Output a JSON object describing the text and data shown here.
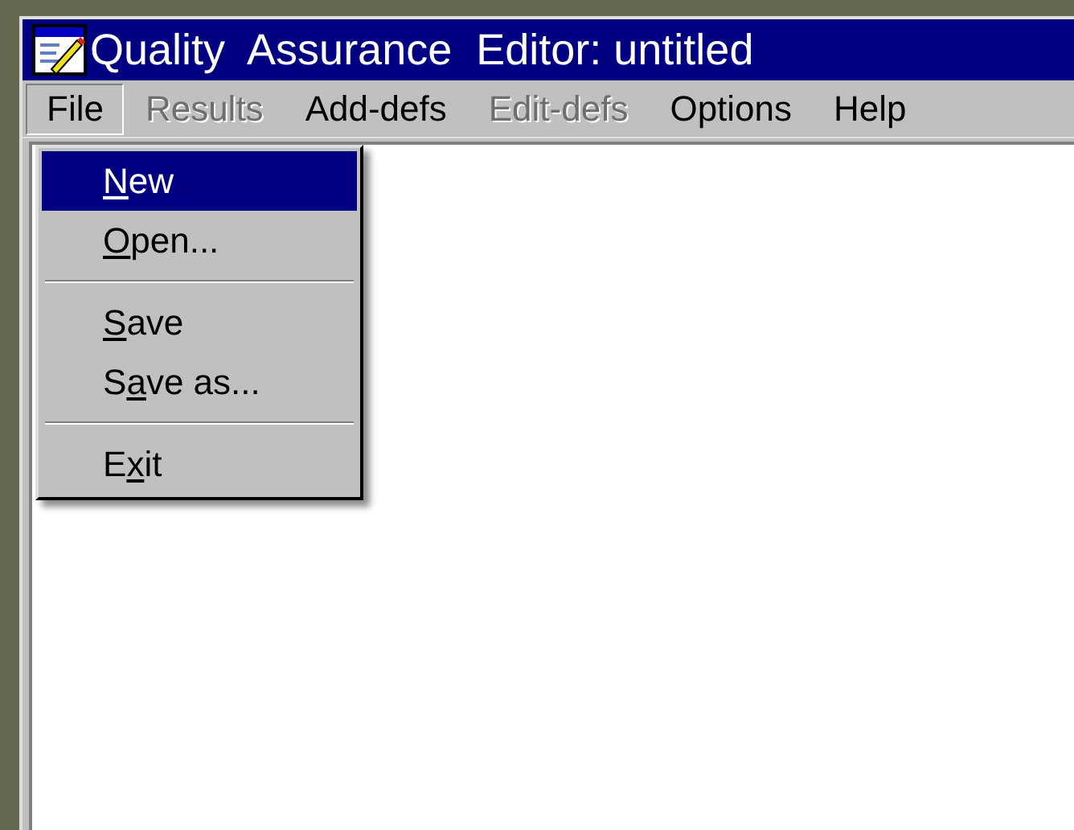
{
  "window": {
    "title": "Quality  Assurance  Editor: untitled"
  },
  "menu_bar": [
    {
      "label": "File",
      "disabled": false,
      "selected": true
    },
    {
      "label": "Results",
      "disabled": true,
      "selected": false
    },
    {
      "label": "Add-defs",
      "disabled": false,
      "selected": false
    },
    {
      "label": "Edit-defs",
      "disabled": true,
      "selected": false
    },
    {
      "label": "Options",
      "disabled": false,
      "selected": false
    },
    {
      "label": "Help",
      "disabled": false,
      "selected": false
    }
  ],
  "file_menu": [
    {
      "kind": "item",
      "key": "N",
      "after": "ew",
      "selected": true
    },
    {
      "kind": "item",
      "key": "O",
      "after": "pen...",
      "selected": false
    },
    {
      "kind": "separator"
    },
    {
      "kind": "item",
      "key": "S",
      "after": "ave",
      "selected": false
    },
    {
      "kind": "item",
      "before": "S",
      "key": "a",
      "after": "ve as...",
      "selected": false
    },
    {
      "kind": "separator"
    },
    {
      "kind": "item",
      "before": "E",
      "key": "x",
      "after": "it",
      "selected": false
    }
  ]
}
